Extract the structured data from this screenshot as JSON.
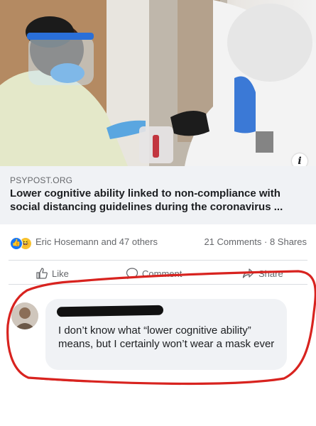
{
  "link_preview": {
    "image_alt": "",
    "info_icon_glyph": "i",
    "domain": "PSYPOST.ORG",
    "title": "Lower cognitive ability linked to non-compliance with social distancing guidelines during the coronavirus ..."
  },
  "reactions": {
    "icons": [
      "like-icon",
      "haha-icon"
    ],
    "like_glyph": "👍",
    "haha_glyph": "😆",
    "names": "Eric Hosemann and 47 others",
    "comments": "21 Comments",
    "separator": "·",
    "shares": "8 Shares"
  },
  "actions": {
    "like": "Like",
    "comment": "Comment",
    "share": "Share"
  },
  "comment": {
    "author_redacted": true,
    "text": "I don’t know what “lower cognitive ability” means, but I certainly won’t wear a mask ever"
  },
  "colors": {
    "accent": "#1877f2",
    "muted_text": "#65676b",
    "bubble_bg": "#f0f2f5",
    "annotation_red": "#d8231f"
  }
}
